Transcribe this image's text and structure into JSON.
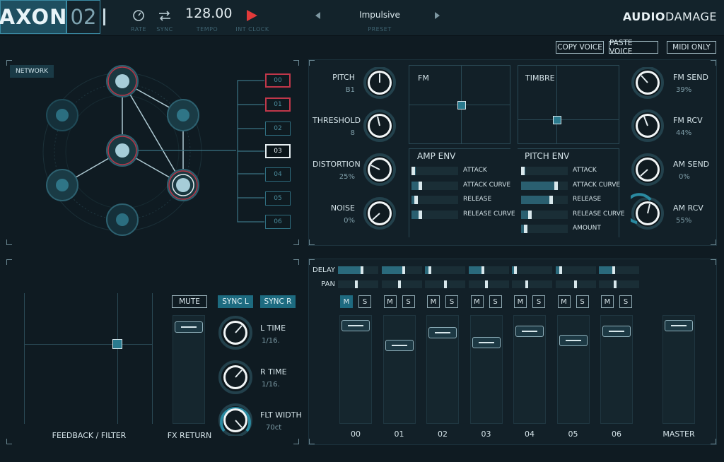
{
  "header": {
    "logo": "AXON",
    "logo_num": "02",
    "rate_label": "RATE",
    "sync_label": "SYNC",
    "tempo_value": "128.00",
    "tempo_label": "TEMPO",
    "clock_label": "INT CLOCK",
    "preset_name": "Impulsive",
    "preset_label": "PRESET",
    "brand_a": "AUDIO",
    "brand_b": "DAMAGE"
  },
  "voice_buttons": {
    "copy": "COPY VOICE",
    "paste": "PASTE VOICE",
    "midi": "MIDI ONLY"
  },
  "network": {
    "label": "NETWORK",
    "nodes": [
      "00",
      "01",
      "02",
      "03",
      "04",
      "05",
      "06"
    ]
  },
  "voice": {
    "knobs_left": [
      {
        "label": "PITCH",
        "value": "B1"
      },
      {
        "label": "THRESHOLD",
        "value": "8"
      },
      {
        "label": "DISTORTION",
        "value": "25%"
      },
      {
        "label": "NOISE",
        "value": "0%"
      }
    ],
    "knobs_right": [
      {
        "label": "FM SEND",
        "value": "39%"
      },
      {
        "label": "FM RCV",
        "value": "44%"
      },
      {
        "label": "AM SEND",
        "value": "0%"
      },
      {
        "label": "AM RCV",
        "value": "55%"
      }
    ],
    "fm_label": "FM",
    "timbre_label": "TIMBRE",
    "amp_env": {
      "title": "AMP ENV",
      "rows": [
        {
          "label": "ATTACK",
          "fill": 0.05
        },
        {
          "label": "ATTACK CURVE",
          "fill": 0.2
        },
        {
          "label": "RELEASE",
          "fill": 0.1
        },
        {
          "label": "RELEASE CURVE",
          "fill": 0.2
        }
      ]
    },
    "pitch_env": {
      "title": "PITCH ENV",
      "rows": [
        {
          "label": "ATTACK",
          "fill": 0.05
        },
        {
          "label": "ATTACK CURVE",
          "fill": 0.75
        },
        {
          "label": "RELEASE",
          "fill": 0.65
        },
        {
          "label": "RELEASE CURVE",
          "fill": 0.2
        },
        {
          "label": "AMOUNT",
          "fill": 0.1
        }
      ]
    }
  },
  "fx": {
    "mute": "MUTE",
    "sync_l": "SYNC L",
    "sync_r": "SYNC R",
    "feedback_label": "FEEDBACK / FILTER",
    "fx_return_label": "FX RETURN",
    "knobs": [
      {
        "label": "L TIME",
        "value": "1/16."
      },
      {
        "label": "R TIME",
        "value": "1/16."
      },
      {
        "label": "FLT WIDTH",
        "value": "70ct"
      }
    ]
  },
  "mixer": {
    "delay_label": "DELAY",
    "pan_label": "PAN",
    "m_label": "M",
    "s_label": "S",
    "master_label": "MASTER",
    "channels": [
      {
        "name": "00",
        "delay": 0.6,
        "pan": 0.45,
        "fader": 0.95,
        "muted": true
      },
      {
        "name": "01",
        "delay": 0.55,
        "pan": 0.45,
        "fader": 0.75,
        "muted": false
      },
      {
        "name": "02",
        "delay": 0.1,
        "pan": 0.5,
        "fader": 0.88,
        "muted": false
      },
      {
        "name": "03",
        "delay": 0.35,
        "pan": 0.45,
        "fader": 0.78,
        "muted": false
      },
      {
        "name": "04",
        "delay": 0.05,
        "pan": 0.35,
        "fader": 0.89,
        "muted": false
      },
      {
        "name": "05",
        "delay": 0.1,
        "pan": 0.5,
        "fader": 0.8,
        "muted": false
      },
      {
        "name": "06",
        "delay": 0.35,
        "pan": 0.4,
        "fader": 0.89,
        "muted": false
      }
    ],
    "master_fader": 0.95
  }
}
